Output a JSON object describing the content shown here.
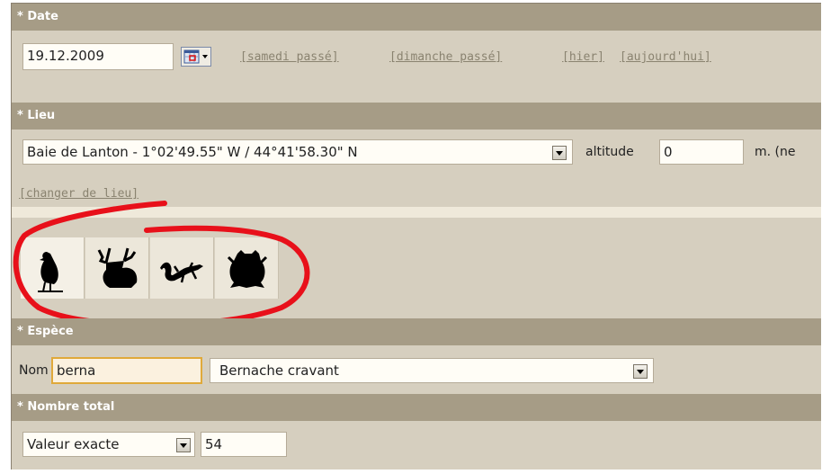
{
  "date": {
    "header": "Date",
    "value": "19.12.2009",
    "shortcuts": [
      "[samedi passé]",
      "[dimanche passé]",
      "[hier]",
      "[aujourd'hui]"
    ]
  },
  "lieu": {
    "header": "Lieu",
    "selected": "Baie de Lanton - 1°02'49.55\" W / 44°41'58.30\" N",
    "altitude_label": "altitude",
    "altitude_value": "0",
    "unit_note": "m. (ne",
    "change_link": "[changer de lieu]"
  },
  "taxon_tabs": [
    {
      "icon": "bird-icon",
      "selected": true
    },
    {
      "icon": "deer-icon",
      "selected": false
    },
    {
      "icon": "lizard-icon",
      "selected": false
    },
    {
      "icon": "frog-icon",
      "selected": false
    }
  ],
  "espece": {
    "header": "Espèce",
    "nom_label": "Nom",
    "search_value": "berna",
    "selected_species": "Bernache cravant"
  },
  "nombre": {
    "header": "Nombre total",
    "mode": "Valeur exacte",
    "value": "54"
  },
  "required_marker": "*",
  "colors": {
    "header_bg": "#a69c86",
    "panel_bg": "#d6cfbf",
    "annotation": "#e8101a",
    "focus": "#e0a93a"
  }
}
